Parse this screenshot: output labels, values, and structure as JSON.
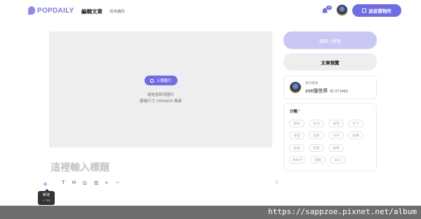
{
  "header": {
    "logo_text": "POPDAILY",
    "nav_title": "編輯文章",
    "draft_status": "尚未儲存",
    "notification_count": "29",
    "shop_label": "波波選物所"
  },
  "cover": {
    "upload_label": "上傳圖片",
    "hint_line1": "或拖曳新增圖片",
    "hint_line2": "建議尺寸 1560x820 像素"
  },
  "editor": {
    "title_placeholder": "這裡輸入標題",
    "toolbar": {
      "add": "+",
      "text": "T",
      "heading": "H",
      "image": "⊡",
      "list": "☰",
      "quote": "»",
      "divider": "--",
      "drag": "⠿"
    },
    "tooltip": {
      "label": "新增",
      "shortcut": "⇥ Tab"
    }
  },
  "sidebar": {
    "publish_label": "發佈 / 排程",
    "preview_label": "文章預覽",
    "account": {
      "label": "發文帳號",
      "name": "zoe搜世界",
      "id": "ID 271493"
    },
    "category": {
      "title": "分類",
      "required_mark": "*",
      "chips": [
        "美妝",
        "生活",
        "穿搭",
        "打卡",
        "穿搭",
        "追星",
        "日本",
        "娛樂",
        "星座",
        "戀愛",
        "寵物",
        "嗚咻兒",
        "運動",
        "日記"
      ]
    }
  },
  "watermark": {
    "text": "https://sappzoe.pixnet.net/album"
  },
  "colors": {
    "accent": "#6f6ce8",
    "publish_disabled": "#c9c7f5",
    "cover_bg": "#eeeeee",
    "watermark_bg": "#6e6e6e"
  }
}
